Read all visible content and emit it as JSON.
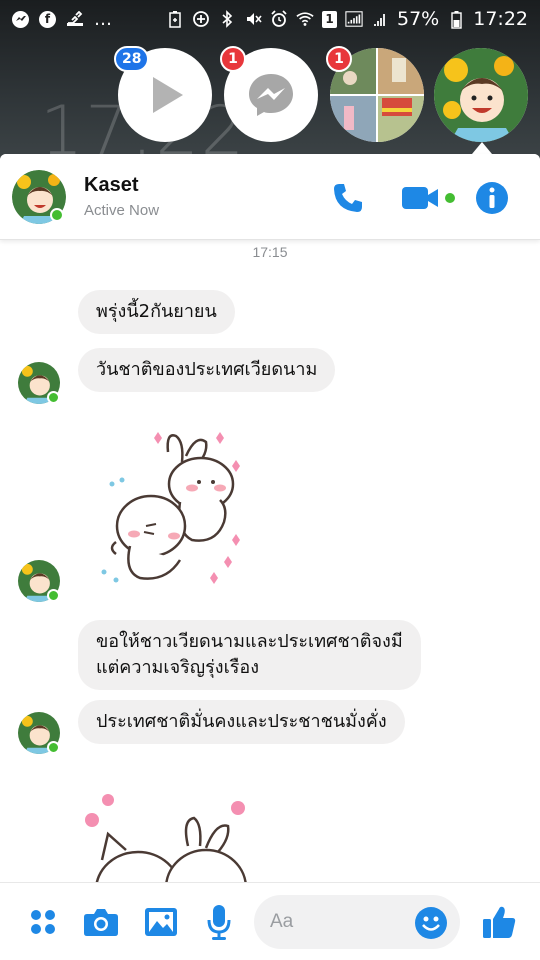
{
  "status_bar": {
    "battery": "57%",
    "time": "17:22",
    "sim_label": "1"
  },
  "lockscreen_clock": "17:22",
  "chat_heads": [
    {
      "type": "video",
      "badge": "28",
      "badge_color": "#1e74e8"
    },
    {
      "type": "messenger",
      "badge": "1",
      "badge_color": "#e8373b"
    },
    {
      "type": "group-photo",
      "badge": "1",
      "badge_color": "#e8373b"
    },
    {
      "type": "kaset-avatar",
      "badge": ""
    }
  ],
  "header": {
    "name": "Kaset",
    "status": "Active Now"
  },
  "conversation": {
    "timestamp": "17:15",
    "messages": [
      {
        "kind": "text",
        "text": "พรุ่งนี้2กันยายน"
      },
      {
        "kind": "text",
        "text": "วันชาติของประเทศเวียดนาม"
      },
      {
        "kind": "sticker",
        "sticker": "hugging-bunnies"
      },
      {
        "kind": "text",
        "line1": "ขอให้ชาวเวียดนามและประเทศชาติจงมี",
        "line2": "แต่ความเจริญรุ่งเรือง"
      },
      {
        "kind": "text",
        "text": "ประเทศชาติมั่นคงและประชาชนมั่งคั่ง"
      },
      {
        "kind": "sticker",
        "sticker": "cat-and-bunny"
      }
    ]
  },
  "composer": {
    "placeholder": "Aa"
  },
  "colors": {
    "accent": "#1e88e5",
    "online": "#44bd32",
    "bubble": "#f1f0f0"
  }
}
